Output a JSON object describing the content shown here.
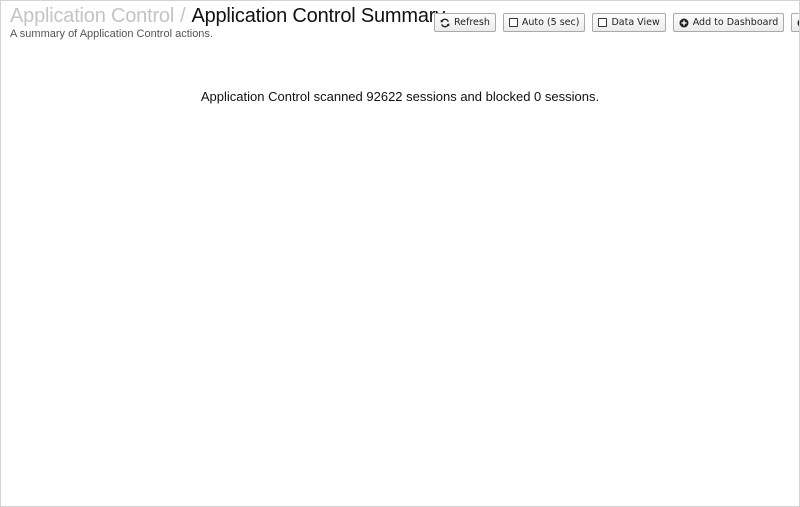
{
  "header": {
    "breadcrumb_parent": "Application Control",
    "breadcrumb_separator": "/",
    "title": "Application Control Summary",
    "subtitle": "A summary of Application Control actions."
  },
  "toolbar": {
    "refresh_label": "Refresh",
    "auto_label": "Auto (5 sec)",
    "data_view_label": "Data View",
    "add_dashboard_label": "Add to Dashboard"
  },
  "main": {
    "summary_text": "Application Control scanned 92622 sessions and blocked 0 sessions."
  }
}
